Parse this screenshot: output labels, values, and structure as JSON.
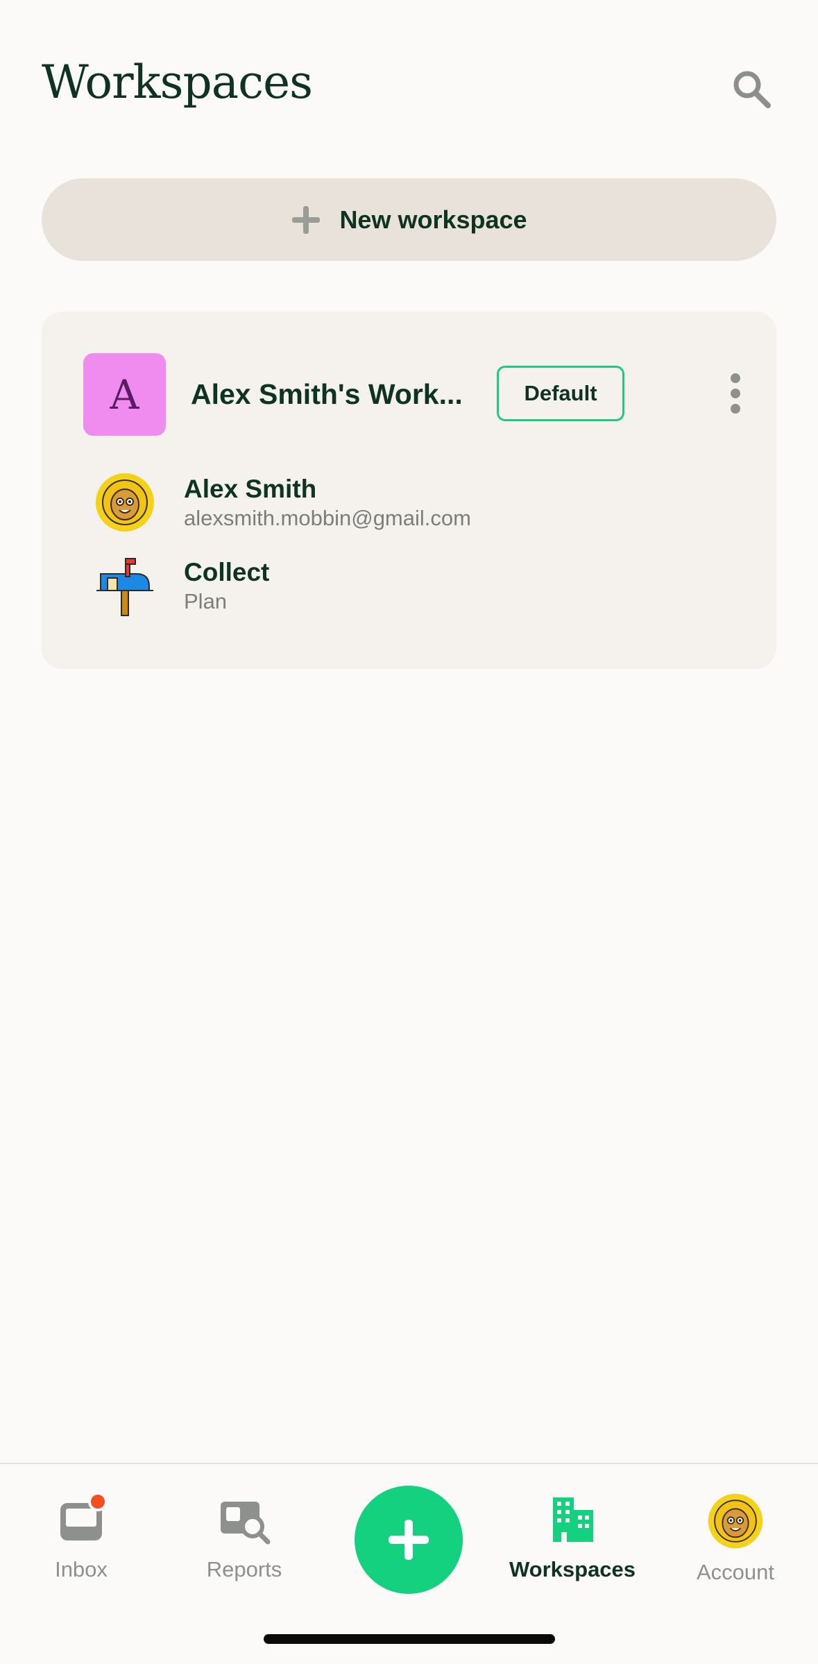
{
  "header": {
    "title": "Workspaces"
  },
  "new_workspace": {
    "label": "New workspace"
  },
  "workspace": {
    "avatar_letter": "A",
    "name": "Alex Smith's Work...",
    "badge": "Default",
    "owner": {
      "name": "Alex Smith",
      "email": "alexsmith.mobbin@gmail.com"
    },
    "plan": {
      "name": "Collect",
      "label": "Plan"
    }
  },
  "tabs": [
    {
      "label": "Inbox",
      "icon": "inbox-icon",
      "has_notification": true
    },
    {
      "label": "Reports",
      "icon": "reports-icon"
    },
    {
      "label": "",
      "icon": "plus-icon"
    },
    {
      "label": "Workspaces",
      "icon": "buildings-icon",
      "active": true
    },
    {
      "label": "Account",
      "icon": "avatar-icon"
    }
  ],
  "colors": {
    "accent": "#14D17F",
    "text": "#0E3323",
    "muted": "#8E908E",
    "background": "#FBFAF8",
    "notification": "#F04E23",
    "workspace_avatar": "#F08CF0"
  }
}
